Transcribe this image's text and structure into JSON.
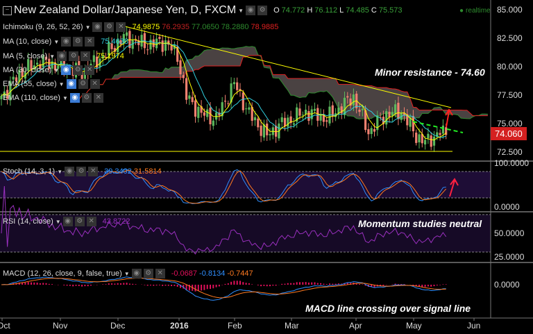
{
  "header": {
    "title": "New Zealand Dollar/Japanese Yen, D, FXCM",
    "o_label": "O",
    "o": "74.772",
    "h_label": "H",
    "h": "76.112",
    "l_label": "L",
    "l": "74.485",
    "c_label": "C",
    "c": "75.573",
    "realtime": "realtime"
  },
  "indicators": [
    {
      "label": "Ichimoku (9, 26, 52, 26)",
      "values": [
        "74.9875",
        "76.2935",
        "77.0650",
        "78.2880",
        "78.9885"
      ],
      "colors": [
        "#ffff00",
        "#c02020",
        "#2e8b2e",
        "#2e8b2e",
        "#e02020"
      ]
    },
    {
      "label": "MA (10, close)",
      "values": [
        "75.4638"
      ],
      "colors": [
        "#30d0e0"
      ]
    },
    {
      "label": "MA (5, close)",
      "values": [
        "75.1974"
      ],
      "colors": [
        "#ffff00"
      ]
    },
    {
      "label": "MA (30, close)",
      "values": [],
      "colors": []
    },
    {
      "label": "EMA (55, close)",
      "values": [],
      "colors": []
    },
    {
      "label": "EMA (110, close)",
      "values": [],
      "colors": []
    }
  ],
  "stoch": {
    "label": "Stoch (14, 3, 1)",
    "k": "39.3402",
    "d": "31.5814"
  },
  "rsi": {
    "label": "RSI (14, close)",
    "value": "43.8722"
  },
  "macd": {
    "label": "MACD (12, 26, close, 9, false, true)",
    "hist": "-0.0687",
    "macd": "-0.8134",
    "signal": "-0.7447"
  },
  "price_axis": [
    "85.000",
    "82.500",
    "80.000",
    "77.500",
    "75.000",
    "72.500"
  ],
  "last_price": "74.060",
  "stoch_axis": [
    "100.0000",
    "0.0000"
  ],
  "rsi_axis": [
    "50.0000",
    "25.0000"
  ],
  "macd_axis": [
    "0.0000"
  ],
  "time_axis": [
    "Oct",
    "Nov",
    "Dec",
    "2016",
    "Feb",
    "Mar",
    "Apr",
    "May",
    "Jun"
  ],
  "annotations": {
    "resistance": "Minor resistance - 74.60",
    "momentum": "Momentum studies neutral",
    "macd_note": "MACD line crossing over signal line"
  },
  "colors": {
    "up": "#5cb85c",
    "down": "#f08070",
    "stoch_k": "#2f8fff",
    "stoch_d": "#ff7a20",
    "rsi": "#9b30c0",
    "trend": "#ffff00"
  },
  "price_anchors": [
    [
      0,
      77.5
    ],
    [
      2,
      78
    ],
    [
      6,
      79.5
    ],
    [
      13,
      80.5
    ],
    [
      20,
      80.1
    ],
    [
      27,
      79.5
    ],
    [
      34,
      81
    ],
    [
      41,
      82.6
    ],
    [
      48,
      82
    ],
    [
      55,
      82.2
    ],
    [
      59,
      81
    ],
    [
      62,
      77.4
    ],
    [
      67,
      75.9
    ],
    [
      72,
      75.5
    ],
    [
      78,
      78.6
    ],
    [
      83,
      75.9
    ],
    [
      89,
      74
    ],
    [
      93,
      74.9
    ],
    [
      102,
      76.1
    ],
    [
      109,
      75.5
    ],
    [
      118,
      77.4
    ],
    [
      123,
      74.3
    ],
    [
      129,
      75.9
    ],
    [
      134,
      76.1
    ],
    [
      139,
      74
    ],
    [
      142,
      73.4
    ],
    [
      147,
      74.3
    ],
    [
      149,
      74.06
    ]
  ]
}
